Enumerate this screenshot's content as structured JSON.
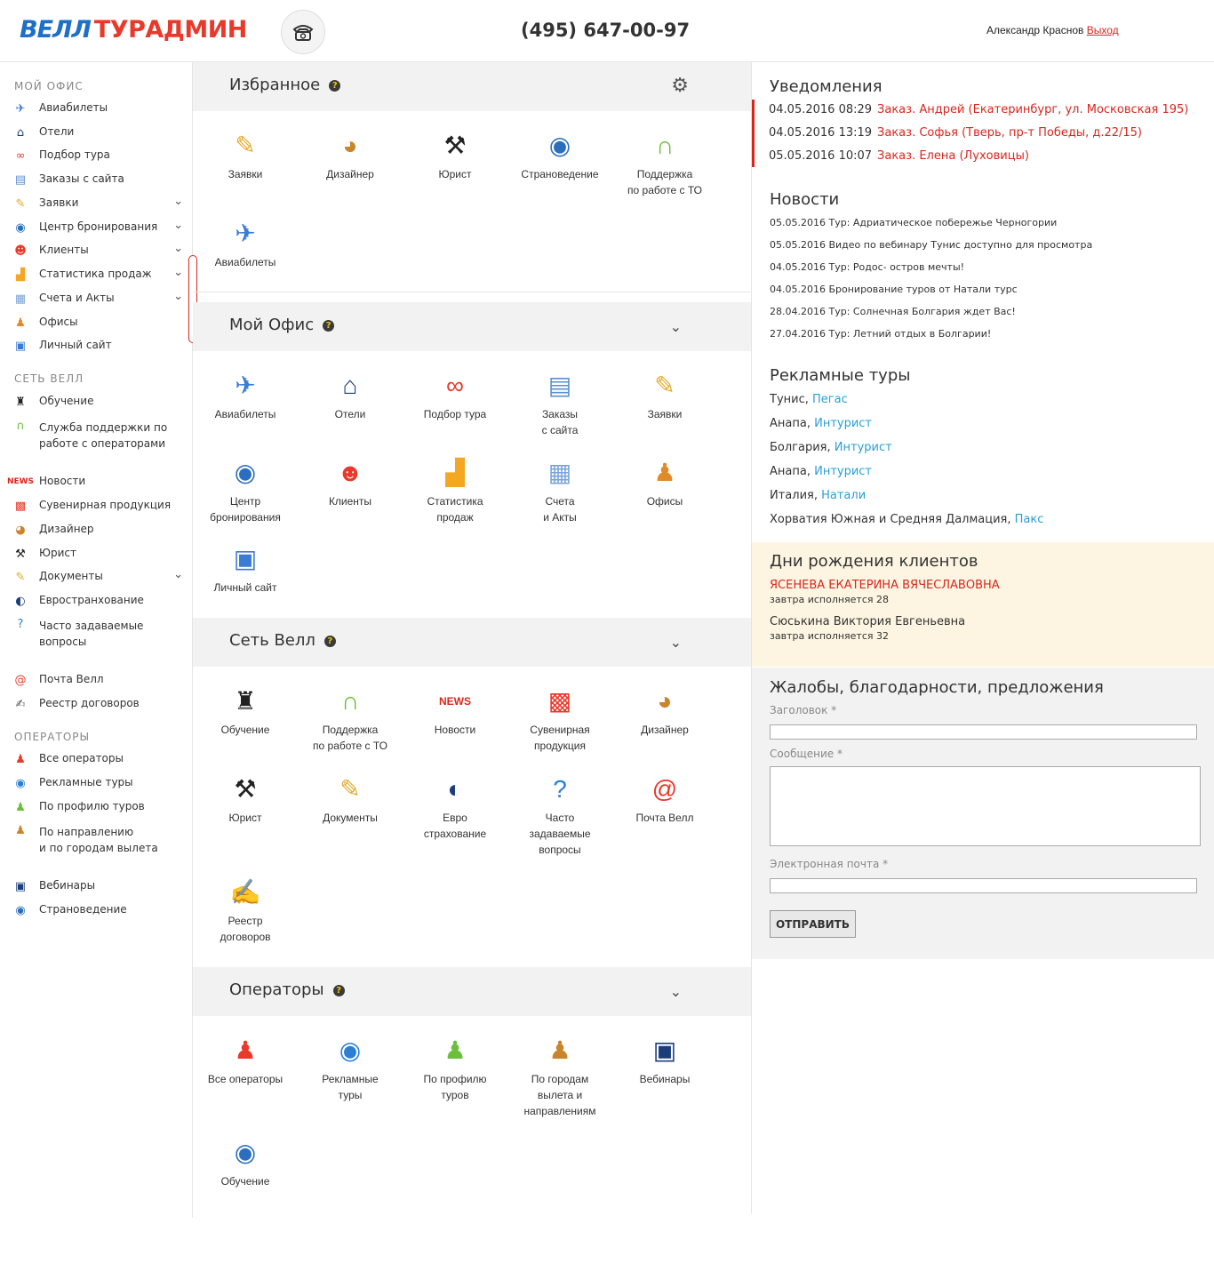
{
  "header": {
    "logo_part1": "ВЕЛЛ",
    "logo_part2": "ТУРАДМИН",
    "phone": "(495) 647-00-97",
    "user_name": "Александр Краснов",
    "logout": "Выход"
  },
  "sidebar": {
    "section_office": "МОЙ ОФИС",
    "section_network": "СЕТЬ ВЕЛЛ",
    "section_operators": "ОПЕРАТОРЫ",
    "office_items": [
      {
        "label": "Авиабилеты",
        "icon": "plane-icon"
      },
      {
        "label": "Отели",
        "icon": "house-icon"
      },
      {
        "label": "Подбор тура",
        "icon": "binoculars-icon"
      },
      {
        "label": "Заказы с сайта",
        "icon": "orders-icon"
      },
      {
        "label": "Заявки",
        "icon": "clip-icon"
      },
      {
        "label": "Центр бронирования",
        "icon": "globe-folder-icon"
      },
      {
        "label": "Клиенты",
        "icon": "clients-icon"
      },
      {
        "label": "Статистика продаж",
        "icon": "chart-icon"
      },
      {
        "label": "Счета и Акты",
        "icon": "calendar-icon"
      },
      {
        "label": "Офисы",
        "icon": "person-icon"
      },
      {
        "label": "Личный сайт",
        "icon": "monitor-icon"
      }
    ],
    "network_items": [
      {
        "label": "Обучение"
      },
      {
        "label": "Служба поддержки по"
      },
      {
        "label": "работе с операторами"
      },
      {
        "label": "Новости"
      },
      {
        "label": "Сувенирная продукция"
      },
      {
        "label": "Дизайнер"
      },
      {
        "label": "Юрист"
      },
      {
        "label": "Документы"
      },
      {
        "label": "Евространхование"
      },
      {
        "label": "Часто задаваемые"
      },
      {
        "label": "вопросы"
      },
      {
        "label": "Почта Велл"
      },
      {
        "label": "Реестр договоров"
      }
    ],
    "operator_items": [
      {
        "label": "Все операторы"
      },
      {
        "label": "Рекламные туры"
      },
      {
        "label": "По профилю туров"
      },
      {
        "label": "По направлению"
      },
      {
        "label": "и по городам вылета"
      },
      {
        "label": "Вебинары"
      },
      {
        "label": "Страноведение"
      }
    ]
  },
  "panels": {
    "favorites": "Избранное",
    "office": "Мой Офис",
    "network": "Сеть Велл",
    "operators": "Операторы",
    "help": "?"
  },
  "tiles": {
    "favorites": [
      {
        "l1": "Заявки",
        "l2": ""
      },
      {
        "l1": "Дизайнер",
        "l2": ""
      },
      {
        "l1": "Юрист",
        "l2": ""
      },
      {
        "l1": "Страноведение",
        "l2": ""
      },
      {
        "l1": "Поддержка",
        "l2": "по работе с ТО"
      },
      {
        "l1": "Авиабилеты",
        "l2": ""
      }
    ],
    "office": [
      {
        "l1": "Авиабилеты",
        "l2": ""
      },
      {
        "l1": "Отели",
        "l2": ""
      },
      {
        "l1": "Подбор тура",
        "l2": ""
      },
      {
        "l1": "Заказы",
        "l2": "с сайта"
      },
      {
        "l1": "Заявки",
        "l2": ""
      },
      {
        "l1": "Центр",
        "l2": "бронирования"
      },
      {
        "l1": "Клиенты",
        "l2": ""
      },
      {
        "l1": "Статистика",
        "l2": "продаж"
      },
      {
        "l1": "Счета",
        "l2": "и Акты"
      },
      {
        "l1": "Офисы",
        "l2": ""
      },
      {
        "l1": "Личный сайт",
        "l2": ""
      }
    ],
    "network": [
      {
        "l1": "Обучение",
        "l2": "",
        "l3": ""
      },
      {
        "l1": "Поддержка",
        "l2": "по работе с ТО",
        "l3": ""
      },
      {
        "l1": "Новости",
        "l2": "",
        "l3": ""
      },
      {
        "l1": "Сувенирная",
        "l2": "продукция",
        "l3": ""
      },
      {
        "l1": "Дизайнер",
        "l2": "",
        "l3": ""
      },
      {
        "l1": "Юрист",
        "l2": "",
        "l3": ""
      },
      {
        "l1": "Документы",
        "l2": "",
        "l3": ""
      },
      {
        "l1": "Евро",
        "l2": "страхование",
        "l3": ""
      },
      {
        "l1": "Часто",
        "l2": "задаваемые",
        "l3": "вопросы"
      },
      {
        "l1": "Почта Велл",
        "l2": "",
        "l3": ""
      },
      {
        "l1": "Реестр",
        "l2": "договоров",
        "l3": ""
      }
    ],
    "operators": [
      {
        "l1": "Все операторы",
        "l2": "",
        "l3": ""
      },
      {
        "l1": "Рекламные",
        "l2": "туры",
        "l3": ""
      },
      {
        "l1": "По профилю",
        "l2": "туров",
        "l3": ""
      },
      {
        "l1": "По городам",
        "l2": "вылета и",
        "l3": "направлениям"
      },
      {
        "l1": "Вебинары",
        "l2": "",
        "l3": ""
      },
      {
        "l1": "Обучение",
        "l2": "",
        "l3": ""
      }
    ]
  },
  "notifications": {
    "title": "Уведомления",
    "items": [
      {
        "date": "04.05.2016 08:29",
        "text": "Заказ. Андрей (Екатеринбург, ул. Московская 195)"
      },
      {
        "date": "04.05.2016 13:19",
        "text": "Заказ. Софья (Тверь, пр-т Победы, д.22/15)"
      },
      {
        "date": "05.05.2016 10:07",
        "text": "Заказ. Елена (Луховицы)"
      }
    ]
  },
  "news": {
    "title": "Новости",
    "items": [
      "05.05.2016 Тур: Адриатическое побережье Черногории",
      "05.05.2016 Видео по вебинару Тунис доступно для просмотра",
      "04.05.2016 Тур: Родос- остров мечты!",
      "04.05.2016 Бронирование туров от Натали турс",
      "28.04.2016 Тур: Солнечная Болгария ждет Вас!",
      "27.04.2016 Тур: Летний отдых в Болгарии!"
    ]
  },
  "tours": {
    "title": "Рекламные туры",
    "items": [
      {
        "place": "Тунис, ",
        "op": "Пегас"
      },
      {
        "place": "Анапа, ",
        "op": "Интурист"
      },
      {
        "place": "Болгария, ",
        "op": "Интурист"
      },
      {
        "place": "Анапа, ",
        "op": "Интурист"
      },
      {
        "place": "Италия, ",
        "op": "Натали"
      },
      {
        "place": "Хорватия Южная и Средняя Далмация, ",
        "op": "Пакс"
      }
    ]
  },
  "birthdays": {
    "title": "Дни рождения клиентов",
    "items": [
      {
        "name": "ЯСЕНЕВА ЕКАТЕРИНА ВЯЧЕСЛАВОВНА",
        "note": "завтра исполняется 28"
      },
      {
        "name": "Сюськина Виктория Евгеньевна",
        "note": "завтра исполняется 32"
      }
    ]
  },
  "feedback": {
    "title": "Жалобы, благодарности, предложения",
    "subject_label": "Заголовок *",
    "message_label": "Сообщение *",
    "email_label": "Электронная почта *",
    "submit": "ОТПРАВИТЬ"
  },
  "colors": {
    "accent_red": "#d9261c",
    "link_blue": "#2a9fd6",
    "panel_gray": "#f2f2f2",
    "birthday_bg": "#fdf5e2"
  }
}
